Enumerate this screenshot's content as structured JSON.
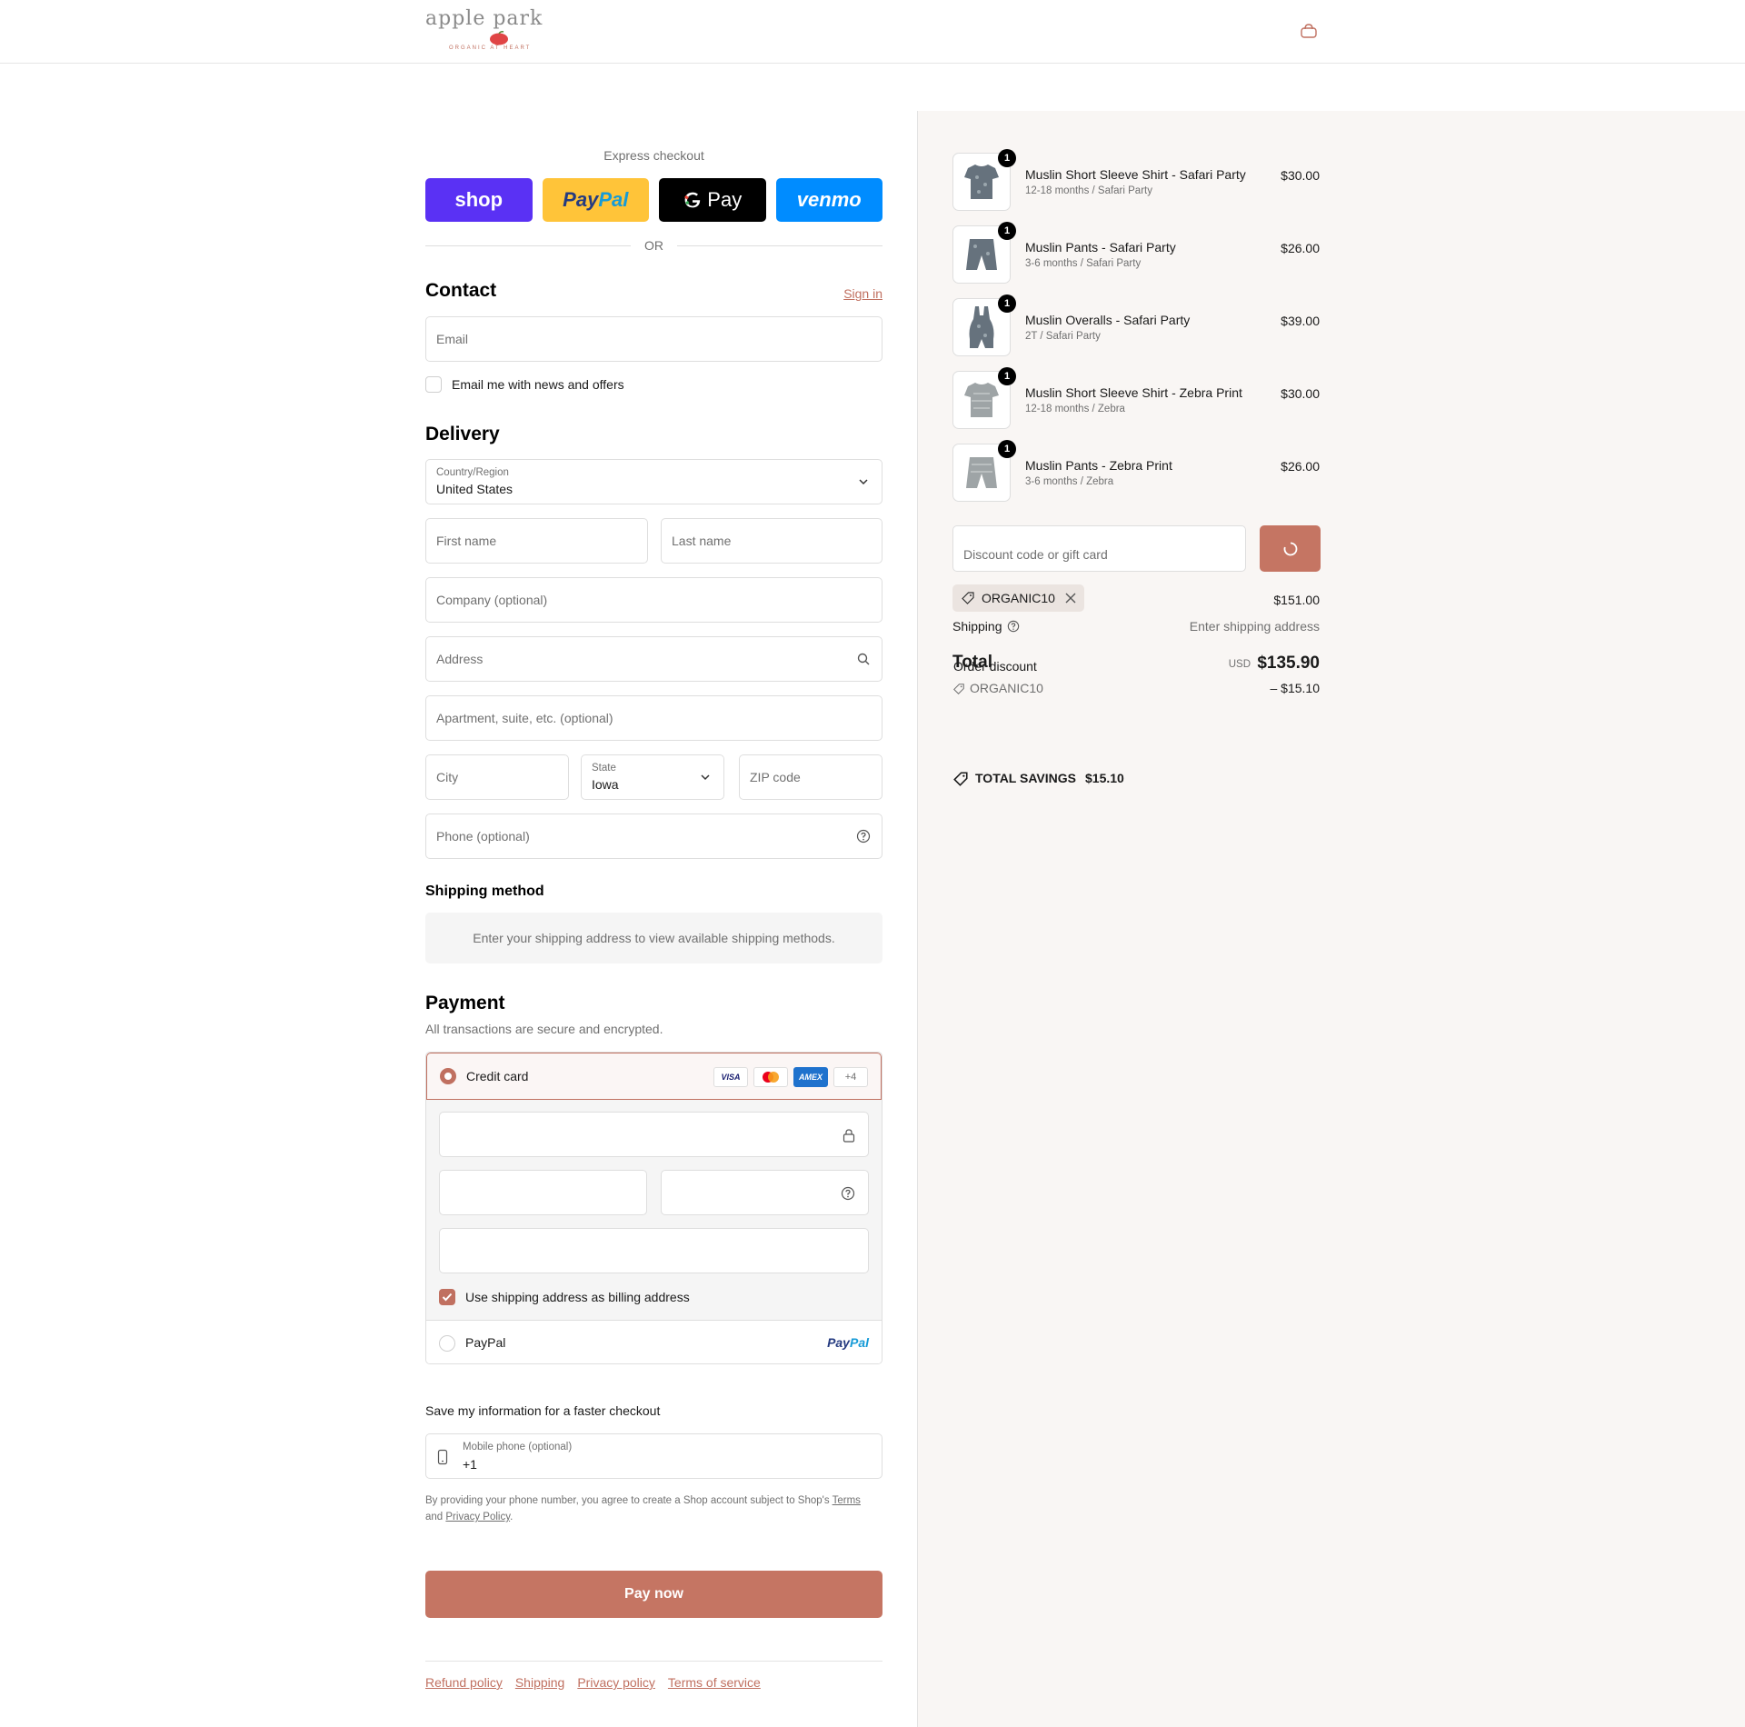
{
  "header": {
    "brand": "apple park",
    "tagline": "ORGANIC AT HEART",
    "cart_icon": "bag-icon"
  },
  "express": {
    "title": "Express checkout",
    "shop_label": "shop",
    "paypal_label_1": "Pay",
    "paypal_label_2": "Pal",
    "gpay_label": "Pay",
    "venmo_label": "venmo",
    "or_label": "OR"
  },
  "contact": {
    "title": "Contact",
    "sign_in": "Sign in",
    "email_placeholder": "Email",
    "newsletter_label": "Email me with news and offers"
  },
  "delivery": {
    "title": "Delivery",
    "country_label": "Country/Region",
    "country_value": "United States",
    "first_name": "First name",
    "last_name": "Last name",
    "company": "Company (optional)",
    "address": "Address",
    "apartment": "Apartment, suite, etc. (optional)",
    "city": "City",
    "state_label": "State",
    "state_value": "Iowa",
    "zip": "ZIP code",
    "phone": "Phone (optional)"
  },
  "shipping_method": {
    "title": "Shipping method",
    "message": "Enter your shipping address to view available shipping methods."
  },
  "payment": {
    "title": "Payment",
    "subtitle": "All transactions are secure and encrypted.",
    "credit_card_label": "Credit card",
    "card_logos": [
      "VISA",
      "",
      "AMEX",
      "+4"
    ],
    "billing_label": "Use shipping address as billing address",
    "paypal_label": "PayPal",
    "paypal_logo_1": "Pay",
    "paypal_logo_2": "Pal"
  },
  "save_info": {
    "title": "Save my information for a faster checkout",
    "mobile_label": "Mobile phone (optional)",
    "mobile_value": "+1",
    "terms_prefix": "By providing your phone number, you agree to create a Shop account subject to Shop's",
    "terms_link": "Terms",
    "and": "and",
    "privacy_link": "Privacy Policy",
    "period": "."
  },
  "pay_button": "Pay now",
  "footer_links": [
    "Refund policy",
    "Shipping",
    "Privacy policy",
    "Terms of service"
  ],
  "items": [
    {
      "name": "Muslin Short Sleeve Shirt - Safari Party",
      "variant": "12-18 months / Safari Party",
      "price": "$30.00",
      "qty": "1"
    },
    {
      "name": "Muslin Pants - Safari Party",
      "variant": "3-6 months / Safari Party",
      "price": "$26.00",
      "qty": "1"
    },
    {
      "name": "Muslin Overalls - Safari Party",
      "variant": "2T / Safari Party",
      "price": "$39.00",
      "qty": "1"
    },
    {
      "name": "Muslin Short Sleeve Shirt - Zebra Print",
      "variant": "12-18 months / Zebra",
      "price": "$30.00",
      "qty": "1"
    },
    {
      "name": "Muslin Pants - Zebra Print",
      "variant": "3-6 months / Zebra",
      "price": "$26.00",
      "qty": "1"
    }
  ],
  "summary": {
    "discount_placeholder": "Discount code or gift card",
    "applied_code": "ORGANIC10",
    "subtotal": "$151.00",
    "shipping_label": "Shipping",
    "shipping_value": "Enter shipping address",
    "total_label": "Total",
    "order_discount_label": "Order discount",
    "currency": "USD",
    "total_value": "$135.90",
    "discount_code": "ORGANIC10",
    "discount_value": "– $15.10",
    "savings_label": "TOTAL SAVINGS",
    "savings_value": "$15.10"
  },
  "colors": {
    "accent": "#c57563",
    "summary_bg": "#f9f6f4"
  }
}
